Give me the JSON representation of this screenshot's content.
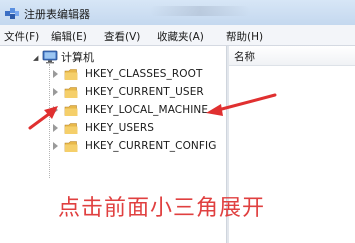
{
  "window": {
    "title": "注册表编辑器"
  },
  "menu": [
    "文件(F)",
    "编辑(E)",
    "查看(V)",
    "收藏夹(A)",
    "帮助(H)"
  ],
  "tree": {
    "root_label": "计算机",
    "nodes": [
      "HKEY_CLASSES_ROOT",
      "HKEY_CURRENT_USER",
      "HKEY_LOCAL_MACHINE",
      "HKEY_USERS",
      "HKEY_CURRENT_CONFIG"
    ]
  },
  "list": {
    "column_name": "名称"
  },
  "annotation": {
    "caption": "点击前面小三角展开",
    "arrow_color": "#e03030",
    "caption_color": "#e04040"
  }
}
